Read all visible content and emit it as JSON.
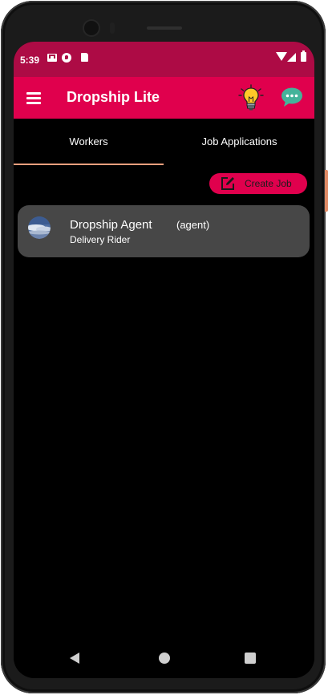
{
  "status_bar": {
    "time": "5:39",
    "icons": [
      "gmail-icon",
      "parking-icon",
      "sd-card-icon",
      "wifi-icon",
      "signal-icon",
      "battery-icon"
    ]
  },
  "app_bar": {
    "title": "Dropship Lite",
    "background": "#e0004d",
    "status_background": "#ad0b45",
    "icons": [
      "menu-icon",
      "lightbulb-icon",
      "chat-icon"
    ]
  },
  "tabs": [
    {
      "label": "Workers",
      "selected": true
    },
    {
      "label": "Job Applications",
      "selected": false
    }
  ],
  "tab_indicator_color": "#f2a07e",
  "create_job": {
    "label": "Create Job",
    "icon": "edit-icon"
  },
  "workers": [
    {
      "name": "Dropship Agent",
      "role": "(agent)",
      "job": "Delivery Rider"
    }
  ],
  "card_background": "#474747",
  "nav_bar": {
    "icons": [
      "back-icon",
      "home-icon",
      "recents-icon"
    ]
  }
}
